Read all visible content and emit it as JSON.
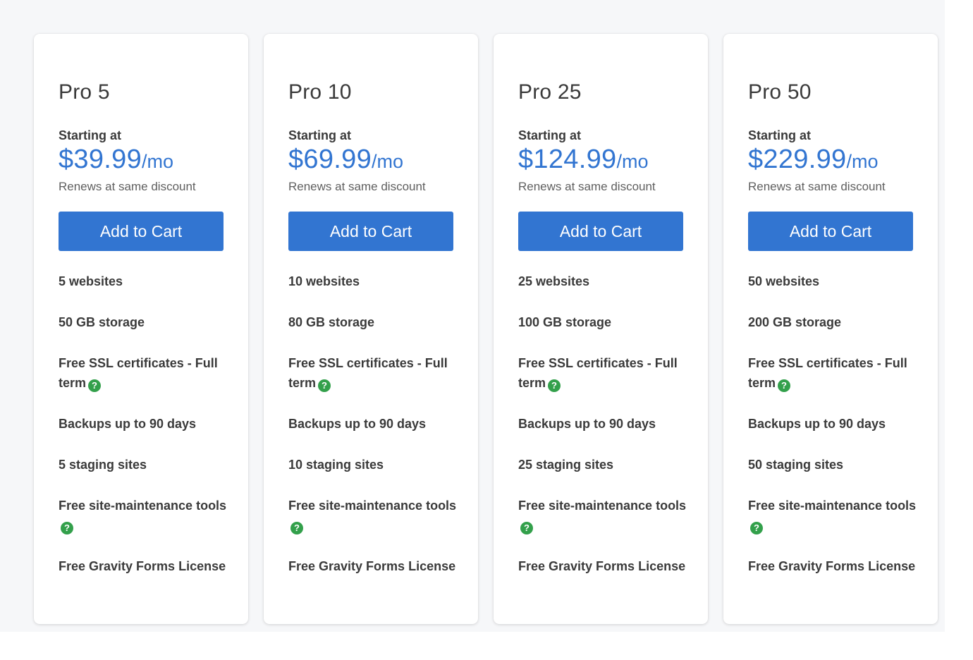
{
  "plans": [
    {
      "name": "Pro 5",
      "starting_label": "Starting at",
      "price": "$39.99",
      "period": "/mo",
      "renew_note": "Renews at same discount",
      "cta_label": "Add to Cart",
      "features": {
        "websites": "5 websites",
        "storage": "50 GB storage",
        "ssl": "Free SSL certificates - Full term",
        "backups": "Backups up to 90 days",
        "staging": "5 staging sites",
        "maintenance": "Free site-maintenance tools",
        "forms": "Free Gravity Forms License"
      }
    },
    {
      "name": "Pro 10",
      "starting_label": "Starting at",
      "price": "$69.99",
      "period": "/mo",
      "renew_note": "Renews at same discount",
      "cta_label": "Add to Cart",
      "features": {
        "websites": "10 websites",
        "storage": "80 GB storage",
        "ssl": "Free SSL certificates - Full term",
        "backups": "Backups up to 90 days",
        "staging": "10 staging sites",
        "maintenance": "Free site-maintenance tools",
        "forms": "Free Gravity Forms License"
      }
    },
    {
      "name": "Pro 25",
      "starting_label": "Starting at",
      "price": "$124.99",
      "period": "/mo",
      "renew_note": "Renews at same discount",
      "cta_label": "Add to Cart",
      "features": {
        "websites": "25 websites",
        "storage": "100 GB storage",
        "ssl": "Free SSL certificates - Full term",
        "backups": "Backups up to 90 days",
        "staging": "25 staging sites",
        "maintenance": "Free site-maintenance tools",
        "forms": "Free Gravity Forms License"
      }
    },
    {
      "name": "Pro 50",
      "starting_label": "Starting at",
      "price": "$229.99",
      "period": "/mo",
      "renew_note": "Renews at same discount",
      "cta_label": "Add to Cart",
      "features": {
        "websites": "50 websites",
        "storage": "200 GB storage",
        "ssl": "Free SSL certificates - Full term",
        "backups": "Backups up to 90 days",
        "staging": "50 staging sites",
        "maintenance": "Free site-maintenance tools",
        "forms": "Free Gravity Forms License"
      }
    }
  ],
  "help_icon_glyph": "?",
  "colors": {
    "accent_blue": "#3275d1",
    "help_green": "#33a04b",
    "text_dark": "#3a3a3a",
    "text_muted": "#5f5f5f",
    "page_background": "#f6f7f9"
  }
}
